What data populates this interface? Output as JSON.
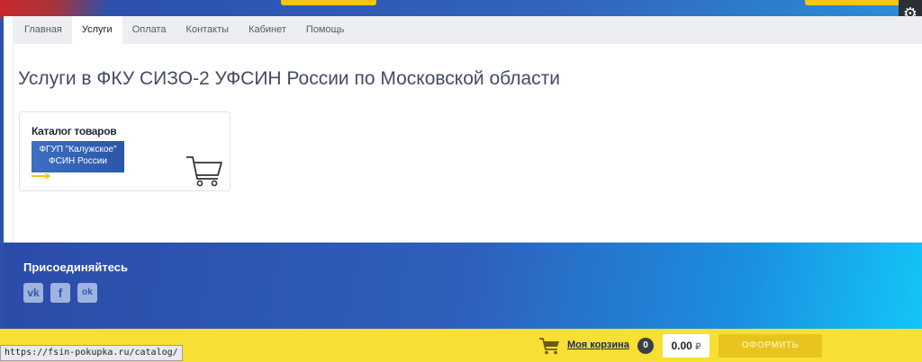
{
  "nav": {
    "tabs": [
      {
        "label": "Главная",
        "active": false
      },
      {
        "label": "Услуги",
        "active": true
      },
      {
        "label": "Оплата",
        "active": false
      },
      {
        "label": "Контакты",
        "active": false
      },
      {
        "label": "Кабинет",
        "active": false
      },
      {
        "label": "Помощь",
        "active": false
      }
    ]
  },
  "main": {
    "title": "Услуги в ФКУ СИЗО-2 УФСИН России по Московской области",
    "card": {
      "title": "Каталог товаров",
      "badge_line1": "ФГУП \"Калужское\"",
      "badge_line2": "ФСИН России",
      "icon": "cart-icon"
    }
  },
  "footer": {
    "title": "Присоединяйтесь",
    "social": [
      {
        "name": "vk-icon",
        "glyph": "vk"
      },
      {
        "name": "facebook-icon",
        "glyph": "f"
      },
      {
        "name": "odnoklassniki-icon",
        "glyph": "ok"
      }
    ]
  },
  "cartbar": {
    "link_label": "Моя корзина",
    "count": "0",
    "sum": "0.00",
    "currency": "₽",
    "checkout_label": "ОФОРМИТЬ"
  },
  "status": {
    "url": "https://fsin-pokupka.ru/catalog/"
  },
  "colors": {
    "brand_blue": "#2d52a8",
    "accent_yellow": "#f7df33",
    "footer_cyan": "#13c5f8"
  }
}
